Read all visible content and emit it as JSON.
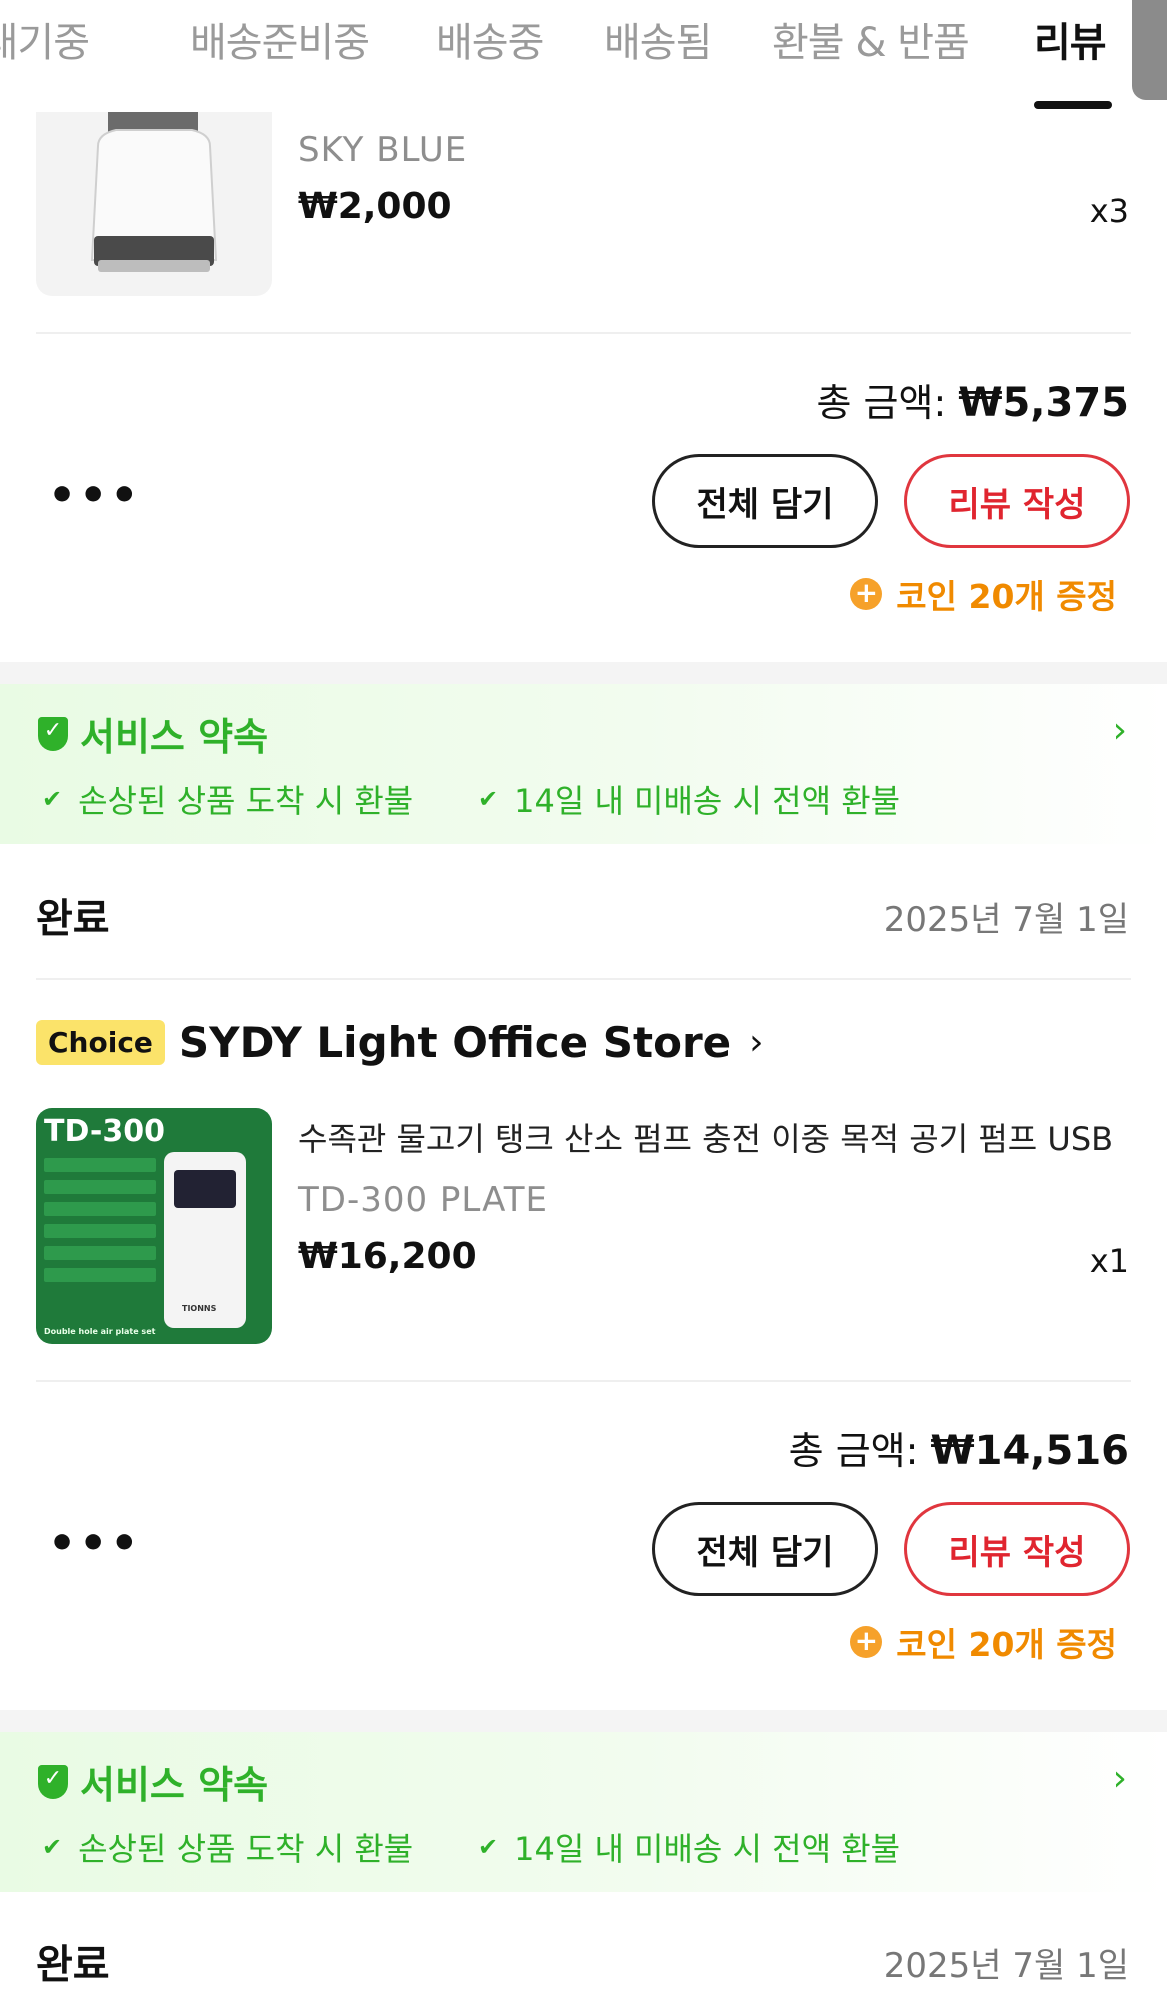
{
  "tabs": [
    {
      "label": "결제대기중"
    },
    {
      "label": "배송준비중"
    },
    {
      "label": "배송중"
    },
    {
      "label": "배송됨"
    },
    {
      "label": "환불 & 반품"
    },
    {
      "label": "리뷰"
    }
  ],
  "orders": [
    {
      "items": [
        {
          "variant": "SKY BLUE",
          "price": "₩2,000",
          "qty": "x3"
        }
      ],
      "total_label": "총 금액:",
      "total_value": "₩5,375",
      "more": "•••",
      "add_all_button": "전체 담기",
      "review_button": "리뷰 작성",
      "coin_text": "코인 20개 증정"
    },
    {
      "status": "완료",
      "date": "2025년 7월 1일",
      "choice_badge": "Choice",
      "store_name": "SYDY Light Office Store",
      "items": [
        {
          "title": "수족관 물고기 탱크 산소 펌프 충전 이중 목적 공기 펌프 USB",
          "variant": "TD-300 PLATE",
          "price": "₩16,200",
          "qty": "x1",
          "image_label": "TD-300",
          "image_brand": "TIONNS",
          "image_caption": "Double hole air plate set"
        }
      ],
      "total_label": "총 금액:",
      "total_value": "₩14,516",
      "more": "•••",
      "add_all_button": "전체 담기",
      "review_button": "리뷰 작성",
      "coin_text": "코인 20개 증정"
    }
  ],
  "service": {
    "title": "서비스 약속",
    "chevron": "›",
    "items": [
      "손상된 상품 도착 시 환불",
      "14일 내 미배송 시 전액 환불"
    ],
    "accent_color": "#2fb12a"
  },
  "next_order": {
    "status": "완료",
    "date": "2025년 7월 1일"
  },
  "colors": {
    "review_red": "#e0252f",
    "coin_orange": "#f08a00",
    "choice_yellow": "#fbe36a"
  }
}
